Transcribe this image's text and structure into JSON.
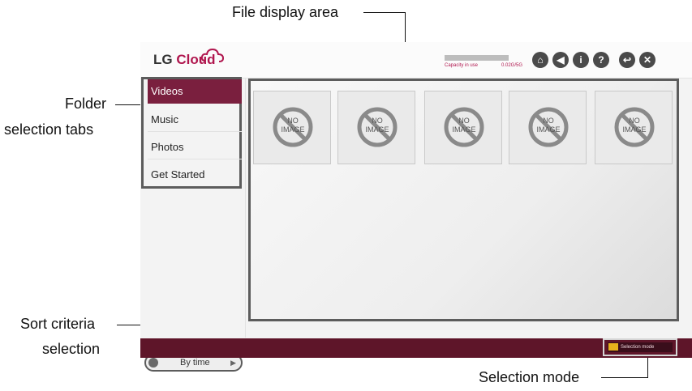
{
  "callouts": {
    "file_display_area": "File display area",
    "folder_line1": "Folder",
    "folder_line2": "selection tabs",
    "sort_line1": "Sort criteria",
    "sort_line2": "selection",
    "selection_mode": "Selection mode"
  },
  "app": {
    "logo_prefix": "LG ",
    "logo_brand": "Cloud",
    "capacity_label": "Capacity in use",
    "capacity_value": "0.02G/5G",
    "toolbar_icons": [
      "home-icon",
      "announce-icon",
      "info-icon",
      "help-icon",
      "back-icon",
      "close-icon"
    ]
  },
  "sidebar": {
    "tabs": [
      {
        "label": "Videos",
        "active": true
      },
      {
        "label": "Music"
      },
      {
        "label": "Photos"
      },
      {
        "label": "Get Started"
      }
    ],
    "sort_label": "By time"
  },
  "files": {
    "items": [
      {
        "placeholder_line1": "NO",
        "placeholder_line2": "IMAGE"
      },
      {
        "placeholder_line1": "NO",
        "placeholder_line2": "IMAGE"
      },
      {
        "placeholder_line1": "NO",
        "placeholder_line2": "IMAGE"
      },
      {
        "placeholder_line1": "NO",
        "placeholder_line2": "IMAGE"
      },
      {
        "placeholder_line1": "NO",
        "placeholder_line2": "IMAGE"
      }
    ]
  },
  "bottombar": {
    "selection_mode_label": "Selection mode"
  },
  "colors": {
    "accent": "#7a1f3e",
    "bottombar": "#5e1529",
    "selection_icon": "#e6b11c"
  }
}
